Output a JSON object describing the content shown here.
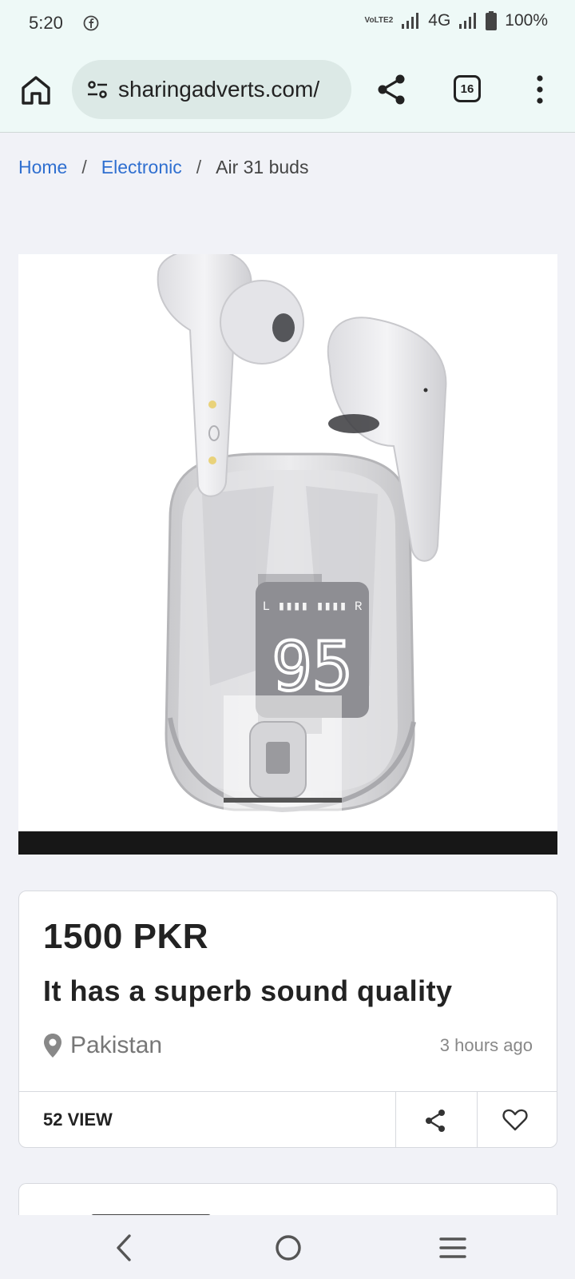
{
  "status_bar": {
    "time": "5:20",
    "network": "4G",
    "battery": "100%",
    "volte_label": "VoLTE2",
    "icons": [
      "facebook-icon",
      "volte-icon",
      "signal-icon",
      "signal-icon",
      "battery-icon"
    ]
  },
  "browser": {
    "url": "sharingadverts.com/",
    "tab_count": "16",
    "icons": [
      "home-icon",
      "site-settings-icon",
      "share-icon",
      "tabs-icon",
      "more-menu-icon"
    ]
  },
  "breadcrumb": {
    "items": [
      "Home",
      "Electronic",
      "Air 31 buds"
    ],
    "separator": "/"
  },
  "product": {
    "price": "1500 PKR",
    "title": "It has a superb sound quality",
    "location": "Pakistan",
    "posted": "3 hours ago",
    "views": "52 VIEW",
    "case_display": "95"
  },
  "colors": {
    "link": "#2f6fd0",
    "browser_bar": "#eef9f7",
    "page_bg": "#f1f2f7"
  },
  "navbar": {
    "icons": [
      "back-icon",
      "home-circle-icon",
      "recent-apps-icon"
    ]
  }
}
